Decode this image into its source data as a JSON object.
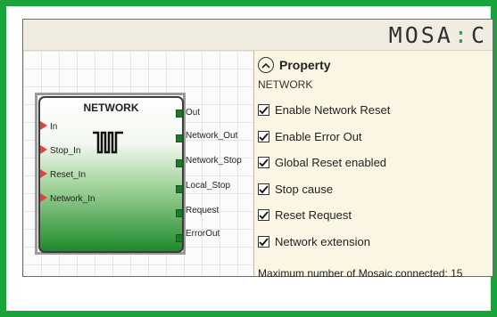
{
  "logo": {
    "text_left": "MOSA",
    "text_right": "C"
  },
  "block": {
    "title": "NETWORK",
    "inputs": [
      "In",
      "Stop_In",
      "Reset_In",
      "Network_In"
    ],
    "outputs": [
      "Out",
      "Network_Out",
      "Network_Stop",
      "Local_Stop",
      "Request",
      "ErrorOut"
    ]
  },
  "property": {
    "title": "Property",
    "subtitle": "NETWORK",
    "options": [
      {
        "label": "Enable Network Reset",
        "checked": true
      },
      {
        "label": "Enable Error Out",
        "checked": true
      },
      {
        "label": "Global Reset enabled",
        "checked": true
      },
      {
        "label": "Stop cause",
        "checked": true
      },
      {
        "label": "Reset Request",
        "checked": true
      },
      {
        "label": "Network extension",
        "checked": true
      }
    ],
    "max_text": "Maximum number of Mosaic connected: 15"
  },
  "colors": {
    "frame": "#1aa33a",
    "panel": "#fbf6e3",
    "input_arrow": "#e8413c",
    "output_port": "#1e7a2a"
  },
  "icons": {
    "collapse": "chevron-up-icon",
    "block": "network-pulse-icon",
    "check": "checkmark-icon"
  }
}
